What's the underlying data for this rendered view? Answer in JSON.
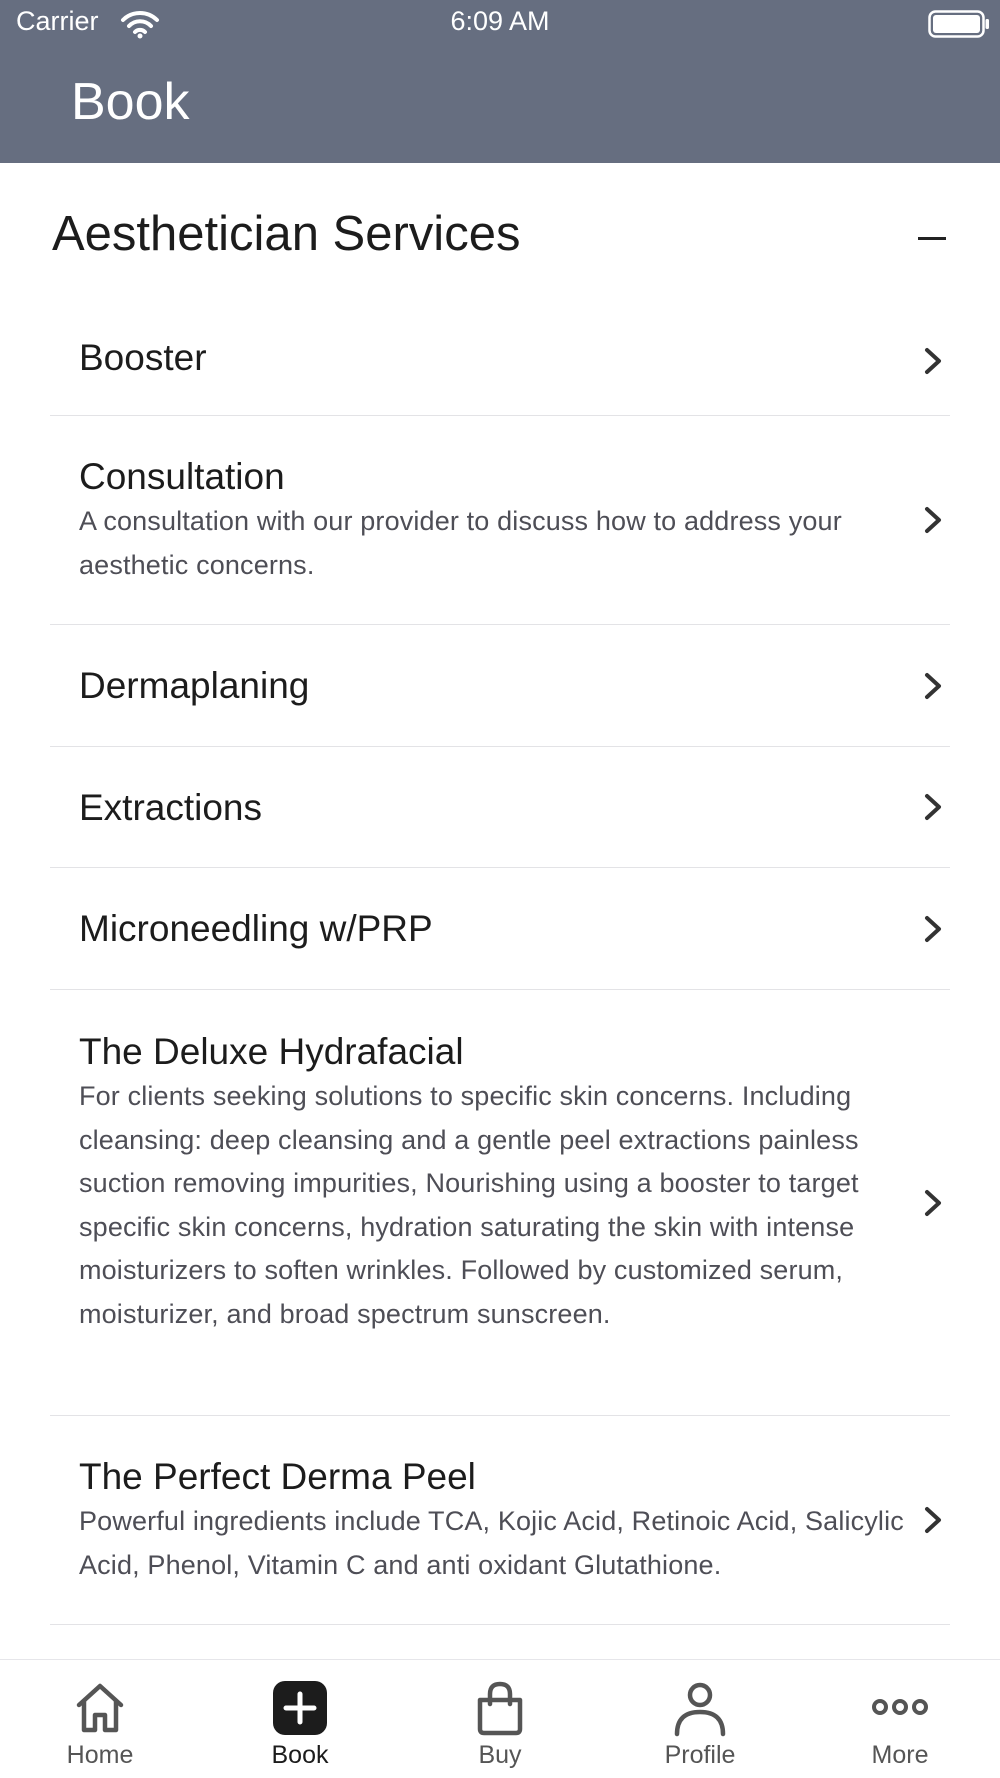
{
  "status_bar": {
    "carrier": "Carrier",
    "time": "6:09 AM"
  },
  "header": {
    "title": "Book",
    "background_color": "#666e80"
  },
  "section": {
    "title": "Aesthetician Services",
    "state": "expanded"
  },
  "services": [
    {
      "name": "Booster",
      "description": ""
    },
    {
      "name": "Consultation",
      "description": "A consultation with our provider to discuss how to address your aesthetic concerns."
    },
    {
      "name": "Dermaplaning",
      "description": ""
    },
    {
      "name": "Extractions",
      "description": ""
    },
    {
      "name": "Microneedling w/PRP",
      "description": ""
    },
    {
      "name": "The Deluxe Hydrafacial",
      "description": "For clients seeking solutions to specific skin concerns. Including cleansing: deep cleansing and a gentle peel extractions painless suction removing impurities, Nourishing using a booster to target specific skin concerns, hydration saturating the skin with intense moisturizers to soften wrinkles. Followed by customized serum, moisturizer, and broad spectrum sunscreen."
    },
    {
      "name": "The Perfect Derma Peel",
      "description": "Powerful ingredients include TCA, Kojic Acid, Retinoic Acid, Salicylic Acid, Phenol, Vitamin C and anti oxidant Glutathione."
    }
  ],
  "tabbar": {
    "active": "book",
    "items": [
      {
        "id": "home",
        "label": "Home",
        "icon": "home-icon"
      },
      {
        "id": "book",
        "label": "Book",
        "icon": "plus-square-icon"
      },
      {
        "id": "buy",
        "label": "Buy",
        "icon": "shopping-bag-icon"
      },
      {
        "id": "profile",
        "label": "Profile",
        "icon": "person-icon"
      },
      {
        "id": "more",
        "label": "More",
        "icon": "more-dots-icon"
      }
    ]
  }
}
